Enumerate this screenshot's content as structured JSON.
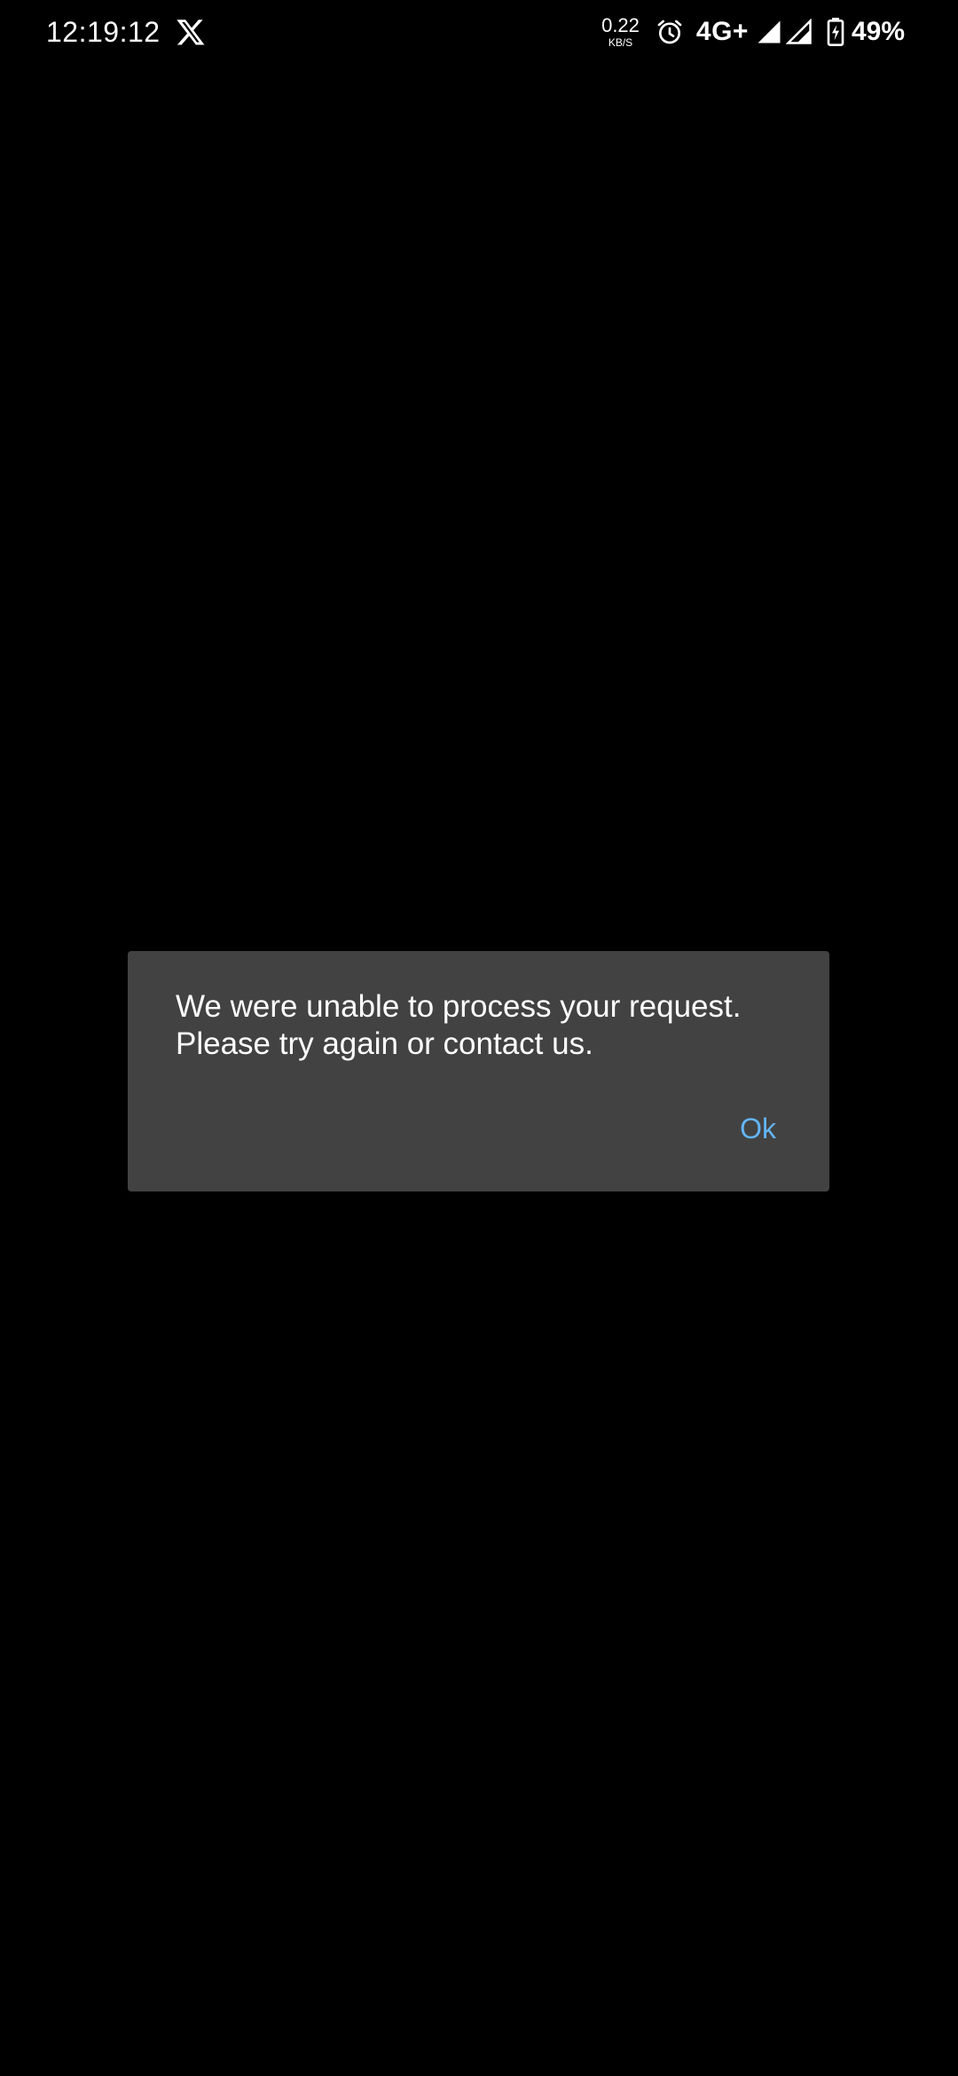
{
  "status_bar": {
    "time": "12:19:12",
    "net_speed_value": "0.22",
    "net_speed_unit": "KB/S",
    "network_type": "4G+",
    "battery_percent": "49%",
    "icons": [
      "x-logo-icon",
      "alarm-icon",
      "signal-icon",
      "signal-icon",
      "battery-charging-icon"
    ]
  },
  "dialog": {
    "message_line1": "We were unable to process your request.",
    "message_line2": "Please try again or contact us.",
    "ok_label": "Ok"
  },
  "colors": {
    "background": "#000000",
    "dialog_background": "#424242",
    "accent": "#64b5f6",
    "text": "#ffffff"
  }
}
